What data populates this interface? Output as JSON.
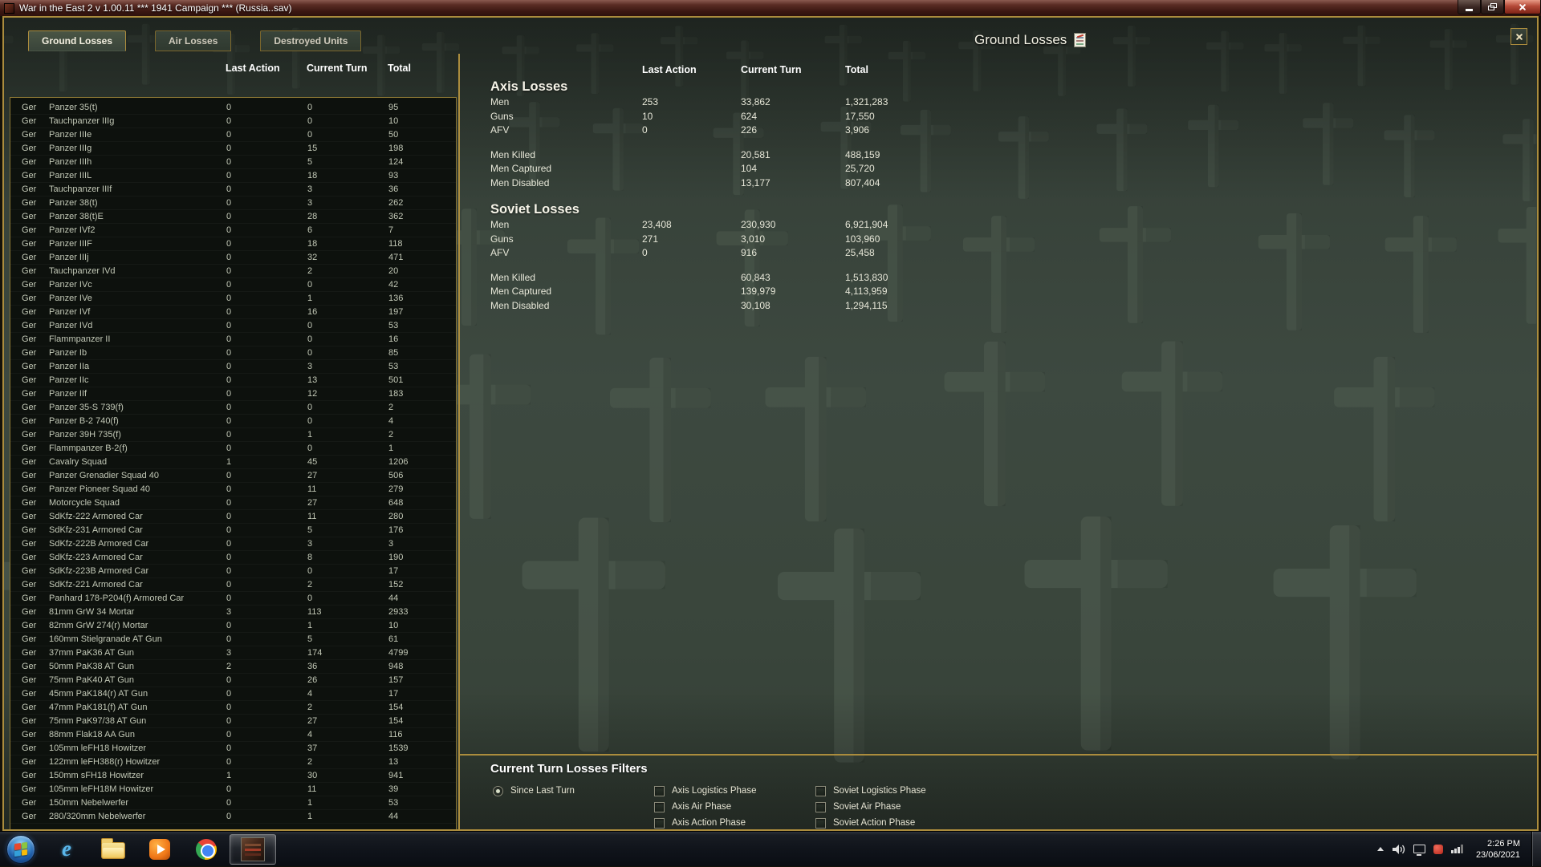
{
  "window": {
    "title": "War in the East 2  v 1.00.11    ***    1941 Campaign    ***    (Russia..sav)",
    "screen_title": "Ground Losses"
  },
  "tabs": [
    {
      "label": "Ground Losses",
      "active": true
    },
    {
      "label": "Air Losses",
      "active": false
    },
    {
      "label": "Destroyed Units",
      "active": false
    }
  ],
  "unit_table": {
    "headers": [
      "Last Action",
      "Current Turn",
      "Total"
    ],
    "rows": [
      [
        "Ger",
        "Panzer 35(t)",
        "0",
        "0",
        "95"
      ],
      [
        "Ger",
        "Tauchpanzer IIIg",
        "0",
        "0",
        "10"
      ],
      [
        "Ger",
        "Panzer IIIe",
        "0",
        "0",
        "50"
      ],
      [
        "Ger",
        "Panzer IIIg",
        "0",
        "15",
        "198"
      ],
      [
        "Ger",
        "Panzer IIIh",
        "0",
        "5",
        "124"
      ],
      [
        "Ger",
        "Panzer IIIL",
        "0",
        "18",
        "93"
      ],
      [
        "Ger",
        "Tauchpanzer IIIf",
        "0",
        "3",
        "36"
      ],
      [
        "Ger",
        "Panzer 38(t)",
        "0",
        "3",
        "262"
      ],
      [
        "Ger",
        "Panzer 38(t)E",
        "0",
        "28",
        "362"
      ],
      [
        "Ger",
        "Panzer IVf2",
        "0",
        "6",
        "7"
      ],
      [
        "Ger",
        "Panzer IIIF",
        "0",
        "18",
        "118"
      ],
      [
        "Ger",
        "Panzer IIIj",
        "0",
        "32",
        "471"
      ],
      [
        "Ger",
        "Tauchpanzer IVd",
        "0",
        "2",
        "20"
      ],
      [
        "Ger",
        "Panzer IVc",
        "0",
        "0",
        "42"
      ],
      [
        "Ger",
        "Panzer IVe",
        "0",
        "1",
        "136"
      ],
      [
        "Ger",
        "Panzer IVf",
        "0",
        "16",
        "197"
      ],
      [
        "Ger",
        "Panzer IVd",
        "0",
        "0",
        "53"
      ],
      [
        "Ger",
        "Flammpanzer II",
        "0",
        "0",
        "16"
      ],
      [
        "Ger",
        "Panzer Ib",
        "0",
        "0",
        "85"
      ],
      [
        "Ger",
        "Panzer IIa",
        "0",
        "3",
        "53"
      ],
      [
        "Ger",
        "Panzer IIc",
        "0",
        "13",
        "501"
      ],
      [
        "Ger",
        "Panzer IIf",
        "0",
        "12",
        "183"
      ],
      [
        "Ger",
        "Panzer 35-S 739(f)",
        "0",
        "0",
        "2"
      ],
      [
        "Ger",
        "Panzer B-2 740(f)",
        "0",
        "0",
        "4"
      ],
      [
        "Ger",
        "Panzer 39H 735(f)",
        "0",
        "1",
        "2"
      ],
      [
        "Ger",
        "Flammpanzer B-2(f)",
        "0",
        "0",
        "1"
      ],
      [
        "Ger",
        "Cavalry Squad",
        "1",
        "45",
        "1206"
      ],
      [
        "Ger",
        "Panzer Grenadier Squad 40",
        "0",
        "27",
        "506"
      ],
      [
        "Ger",
        "Panzer Pioneer Squad 40",
        "0",
        "11",
        "279"
      ],
      [
        "Ger",
        "Motorcycle Squad",
        "0",
        "27",
        "648"
      ],
      [
        "Ger",
        "SdKfz-222 Armored Car",
        "0",
        "11",
        "280"
      ],
      [
        "Ger",
        "SdKfz-231 Armored Car",
        "0",
        "5",
        "176"
      ],
      [
        "Ger",
        "SdKfz-222B Armored Car",
        "0",
        "3",
        "3"
      ],
      [
        "Ger",
        "SdKfz-223 Armored Car",
        "0",
        "8",
        "190"
      ],
      [
        "Ger",
        "SdKfz-223B Armored Car",
        "0",
        "0",
        "17"
      ],
      [
        "Ger",
        "SdKfz-221 Armored Car",
        "0",
        "2",
        "152"
      ],
      [
        "Ger",
        "Panhard 178-P204(f) Armored Car",
        "0",
        "0",
        "44"
      ],
      [
        "Ger",
        "81mm GrW 34 Mortar",
        "3",
        "113",
        "2933"
      ],
      [
        "Ger",
        "82mm GrW 274(r) Mortar",
        "0",
        "1",
        "10"
      ],
      [
        "Ger",
        "160mm Stielgranade AT Gun",
        "0",
        "5",
        "61"
      ],
      [
        "Ger",
        "37mm PaK36 AT Gun",
        "3",
        "174",
        "4799"
      ],
      [
        "Ger",
        "50mm PaK38 AT Gun",
        "2",
        "36",
        "948"
      ],
      [
        "Ger",
        "75mm PaK40 AT Gun",
        "0",
        "26",
        "157"
      ],
      [
        "Ger",
        "45mm PaK184(r) AT Gun",
        "0",
        "4",
        "17"
      ],
      [
        "Ger",
        "47mm PaK181(f) AT Gun",
        "0",
        "2",
        "154"
      ],
      [
        "Ger",
        "75mm PaK97/38 AT Gun",
        "0",
        "27",
        "154"
      ],
      [
        "Ger",
        "88mm Flak18 AA Gun",
        "0",
        "4",
        "116"
      ],
      [
        "Ger",
        "105mm leFH18 Howitzer",
        "0",
        "37",
        "1539"
      ],
      [
        "Ger",
        "122mm leFH388(r) Howitzer",
        "0",
        "2",
        "13"
      ],
      [
        "Ger",
        "150mm sFH18 Howitzer",
        "1",
        "30",
        "941"
      ],
      [
        "Ger",
        "105mm leFH18M Howitzer",
        "0",
        "11",
        "39"
      ],
      [
        "Ger",
        "150mm Nebelwerfer",
        "0",
        "1",
        "53"
      ],
      [
        "Ger",
        "280/320mm Nebelwerfer",
        "0",
        "1",
        "44"
      ]
    ]
  },
  "summary": {
    "headers": [
      "Last Action",
      "Current Turn",
      "Total"
    ],
    "sections": [
      {
        "title": "Axis Losses",
        "groups": [
          [
            [
              "Men",
              "253",
              "33,862",
              "1,321,283"
            ],
            [
              "Guns",
              "10",
              "624",
              "17,550"
            ],
            [
              "AFV",
              "0",
              "226",
              "3,906"
            ]
          ],
          [
            [
              "Men Killed",
              "",
              "20,581",
              "488,159"
            ],
            [
              "Men Captured",
              "",
              "104",
              "25,720"
            ],
            [
              "Men Disabled",
              "",
              "13,177",
              "807,404"
            ]
          ]
        ]
      },
      {
        "title": "Soviet Losses",
        "groups": [
          [
            [
              "Men",
              "23,408",
              "230,930",
              "6,921,904"
            ],
            [
              "Guns",
              "271",
              "3,010",
              "103,960"
            ],
            [
              "AFV",
              "0",
              "916",
              "25,458"
            ]
          ],
          [
            [
              "Men Killed",
              "",
              "60,843",
              "1,513,830"
            ],
            [
              "Men Captured",
              "",
              "139,979",
              "4,113,959"
            ],
            [
              "Men Disabled",
              "",
              "30,108",
              "1,294,115"
            ]
          ]
        ]
      }
    ]
  },
  "filters": {
    "title": "Current Turn Losses Filters",
    "radio": {
      "label": "Since Last Turn",
      "selected": true
    },
    "axis_phases": [
      "Axis Logistics Phase",
      "Axis Air Phase",
      "Axis Action Phase"
    ],
    "soviet_phases": [
      "Soviet Logistics Phase",
      "Soviet Air Phase",
      "Soviet Action Phase"
    ]
  },
  "taskbar": {
    "time": "2:26 PM",
    "date": "23/06/2021"
  },
  "colors": {
    "accent_gold": "#ab8c3d",
    "background_olive": "#39443a",
    "table_panel": "#0d110d"
  }
}
